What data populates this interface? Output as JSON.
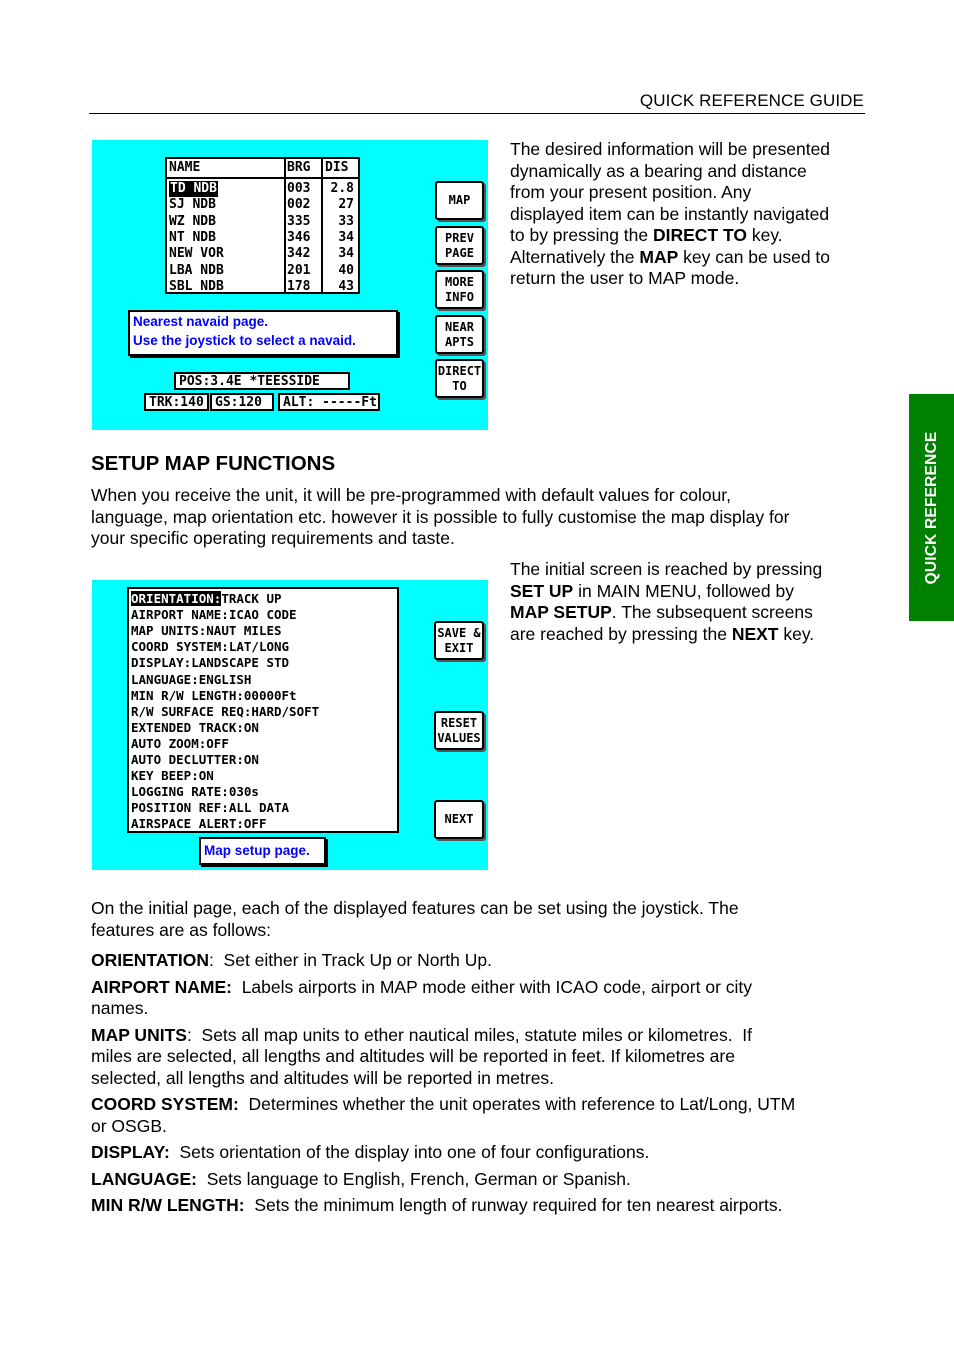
{
  "header": {
    "title": "QUICK REFERENCE GUIDE"
  },
  "side_tab": {
    "label": "QUICK REFERENCE"
  },
  "screen1": {
    "table": {
      "headers": [
        "NAME",
        "BRG",
        "DIS"
      ],
      "rows": [
        {
          "name": "TD NDB",
          "brg": "003",
          "dis": "2.8",
          "selected": true
        },
        {
          "name": "SJ NDB",
          "brg": "002",
          "dis": "27"
        },
        {
          "name": "WZ NDB",
          "brg": "335",
          "dis": "33"
        },
        {
          "name": "NT NDB",
          "brg": "346",
          "dis": "34"
        },
        {
          "name": "NEW VOR",
          "brg": "342",
          "dis": "34"
        },
        {
          "name": "LBA NDB",
          "brg": "201",
          "dis": "40"
        },
        {
          "name": "SBL NDB",
          "brg": "178",
          "dis": "43"
        }
      ]
    },
    "message": {
      "line1": "Nearest navaid page.",
      "line2": "Use the joystick to select a navaid."
    },
    "status": {
      "pos": "POS:3.4E *TEESSIDE",
      "trk": "TRK:140",
      "gs": "GS:120 ",
      "alt": "ALT: -----Ft"
    },
    "buttons": [
      {
        "label": "MAP"
      },
      {
        "label": "PREV\nPAGE"
      },
      {
        "label": "MORE\nINFO"
      },
      {
        "label": "NEAR\nAPTS"
      },
      {
        "label": "DIRECT\nTO"
      }
    ]
  },
  "screen2": {
    "settings": [
      {
        "key": "ORIENTATION:",
        "value": "TRACK UP",
        "selected": true
      },
      {
        "key": "AIRPORT NAME:",
        "value": "ICAO CODE"
      },
      {
        "key": "MAP UNITS:",
        "value": "NAUT MILES"
      },
      {
        "key": "COORD SYSTEM:",
        "value": "LAT/LONG"
      },
      {
        "key": "DISPLAY:",
        "value": "LANDSCAPE STD"
      },
      {
        "key": "LANGUAGE:",
        "value": "ENGLISH"
      },
      {
        "key": "MIN R/W LENGTH:",
        "value": "00000Ft"
      },
      {
        "key": "R/W SURFACE REQ:",
        "value": "HARD/SOFT"
      },
      {
        "key": "EXTENDED TRACK:",
        "value": "ON"
      },
      {
        "key": "AUTO ZOOM:",
        "value": "OFF"
      },
      {
        "key": "AUTO DECLUTTER:",
        "value": "ON"
      },
      {
        "key": "KEY BEEP:",
        "value": "ON"
      },
      {
        "key": "LOGGING RATE:",
        "value": "030s"
      },
      {
        "key": "POSITION REF:",
        "value": "ALL DATA"
      },
      {
        "key": "AIRSPACE ALERT:",
        "value": "OFF"
      }
    ],
    "message": "Map setup page.",
    "buttons": [
      {
        "label": "SAVE &\nEXIT"
      },
      {
        "label": "RESET\nVALUES"
      },
      {
        "label": "NEXT"
      }
    ]
  },
  "text": {
    "p1": [
      "The desired information will be presented",
      "dynamically as a bearing and distance",
      "from your present position.  Any",
      "displayed item can be instantly navigated"
    ],
    "p1_line5_pre": "to by pressing the ",
    "p1_line5_bold": "DIRECT TO",
    "p1_line5_post": " key.",
    "p1_line6_pre": "Alternatively the ",
    "p1_line6_bold": "MAP",
    "p1_line6_post": " key can be used to",
    "p1_line7": "return the user to MAP mode.",
    "section_title": "SETUP MAP FUNCTIONS",
    "intro": [
      "When you receive the unit, it will be pre-programmed with default values for colour,",
      "language, map orientation etc. however it is possible to fully customise the map display for",
      "your specific operating requirements and taste."
    ],
    "p2_line1": "The initial screen is reached by pressing",
    "p2_line2_bold": "SET UP",
    "p2_line2_post": " in MAIN MENU, followed by",
    "p2_line3_bold": "MAP SETUP",
    "p2_line3_post": ".  The subsequent screens",
    "p2_line4_pre": "are reached by pressing the ",
    "p2_line4_bold": "NEXT",
    "p2_line4_post": " key.",
    "p3": [
      "On the initial page, each of the displayed features can be set using the joystick.  The",
      "features are as follows:"
    ],
    "features": [
      {
        "term": "ORIENTATION",
        "sep": ":  ",
        "lines": [
          "Set either in Track Up or North Up."
        ]
      },
      {
        "term": "AIRPORT NAME:",
        "sep": "  ",
        "lines": [
          "Labels airports in MAP mode either with ICAO code, airport or city",
          "names."
        ]
      },
      {
        "term": "MAP UNITS",
        "sep": ":  ",
        "lines": [
          "Sets all map units to ether nautical miles, statute miles or kilometres.  If",
          "miles are selected, all lengths and altitudes will be reported in feet.  If kilometres are",
          "selected, all lengths and altitudes will be reported in metres."
        ]
      },
      {
        "term": "COORD SYSTEM:",
        "sep": "  ",
        "lines": [
          "Determines whether the unit operates with reference to Lat/Long, UTM",
          "or OSGB."
        ]
      },
      {
        "term": "DISPLAY:",
        "sep": "  ",
        "lines": [
          "Sets orientation of the display into one of four configurations."
        ]
      },
      {
        "term": "LANGUAGE:",
        "sep": "  ",
        "lines": [
          "Sets language to English, French, German or Spanish."
        ]
      },
      {
        "term": "MIN R/W LENGTH:",
        "sep": "  ",
        "lines": [
          "Sets the minimum length of runway required for ten nearest airports."
        ]
      }
    ]
  }
}
